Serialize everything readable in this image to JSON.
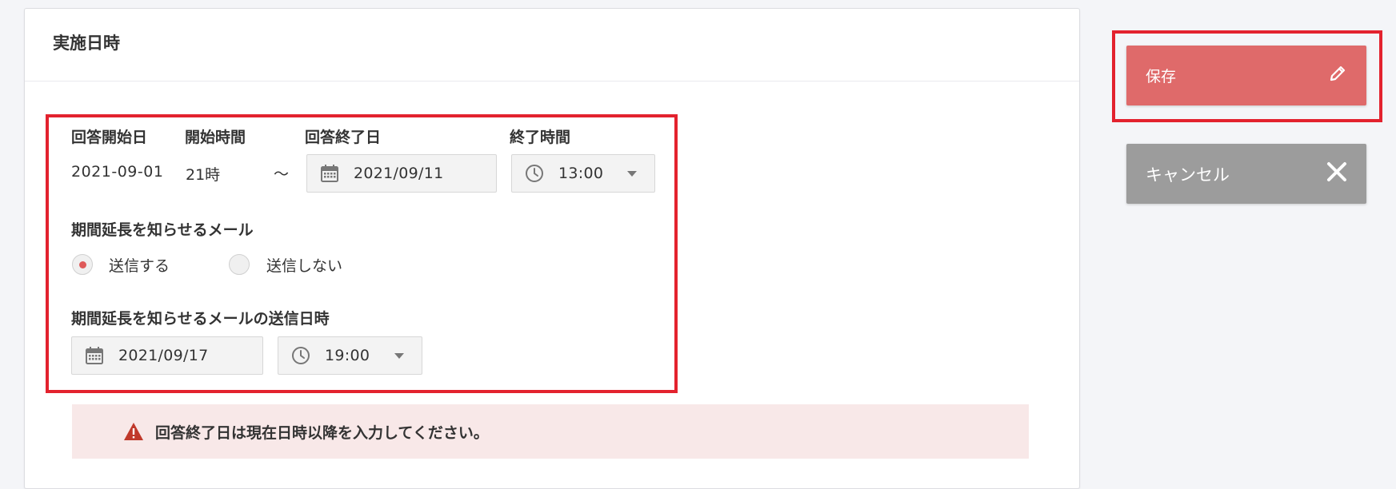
{
  "section": {
    "title": "実施日時"
  },
  "form": {
    "answer_start": {
      "label": "回答開始日",
      "value": "2021-09-01"
    },
    "start_time": {
      "label": "開始時間",
      "value": "21時"
    },
    "range_separator": "～",
    "answer_end": {
      "label": "回答終了日",
      "date_value": "2021/09/11",
      "icon": "calendar-icon"
    },
    "end_time": {
      "label": "終了時間",
      "time_value": "13:00",
      "icon": "clock-icon"
    },
    "extension_mail": {
      "label": "期間延長を知らせるメール",
      "options": [
        {
          "label": "送信する",
          "selected": true
        },
        {
          "label": "送信しない",
          "selected": false
        }
      ]
    },
    "extension_mail_datetime": {
      "label": "期間延長を知らせるメールの送信日時",
      "date_value": "2021/09/17",
      "time_value": "19:00"
    }
  },
  "alert": {
    "icon": "warning-icon",
    "message": "回答終了日は現在日時以降を入力してください。"
  },
  "actions": {
    "save": {
      "label": "保存",
      "icon": "pencil-icon"
    },
    "cancel": {
      "label": "キャンセル",
      "icon": "close-icon"
    }
  },
  "colors": {
    "highlight": "#e3222e",
    "save_bg": "#df6a6a",
    "cancel_bg": "#9c9c9c",
    "alert_bg": "#f8e8e8",
    "radio_on": "#df5a5a"
  }
}
